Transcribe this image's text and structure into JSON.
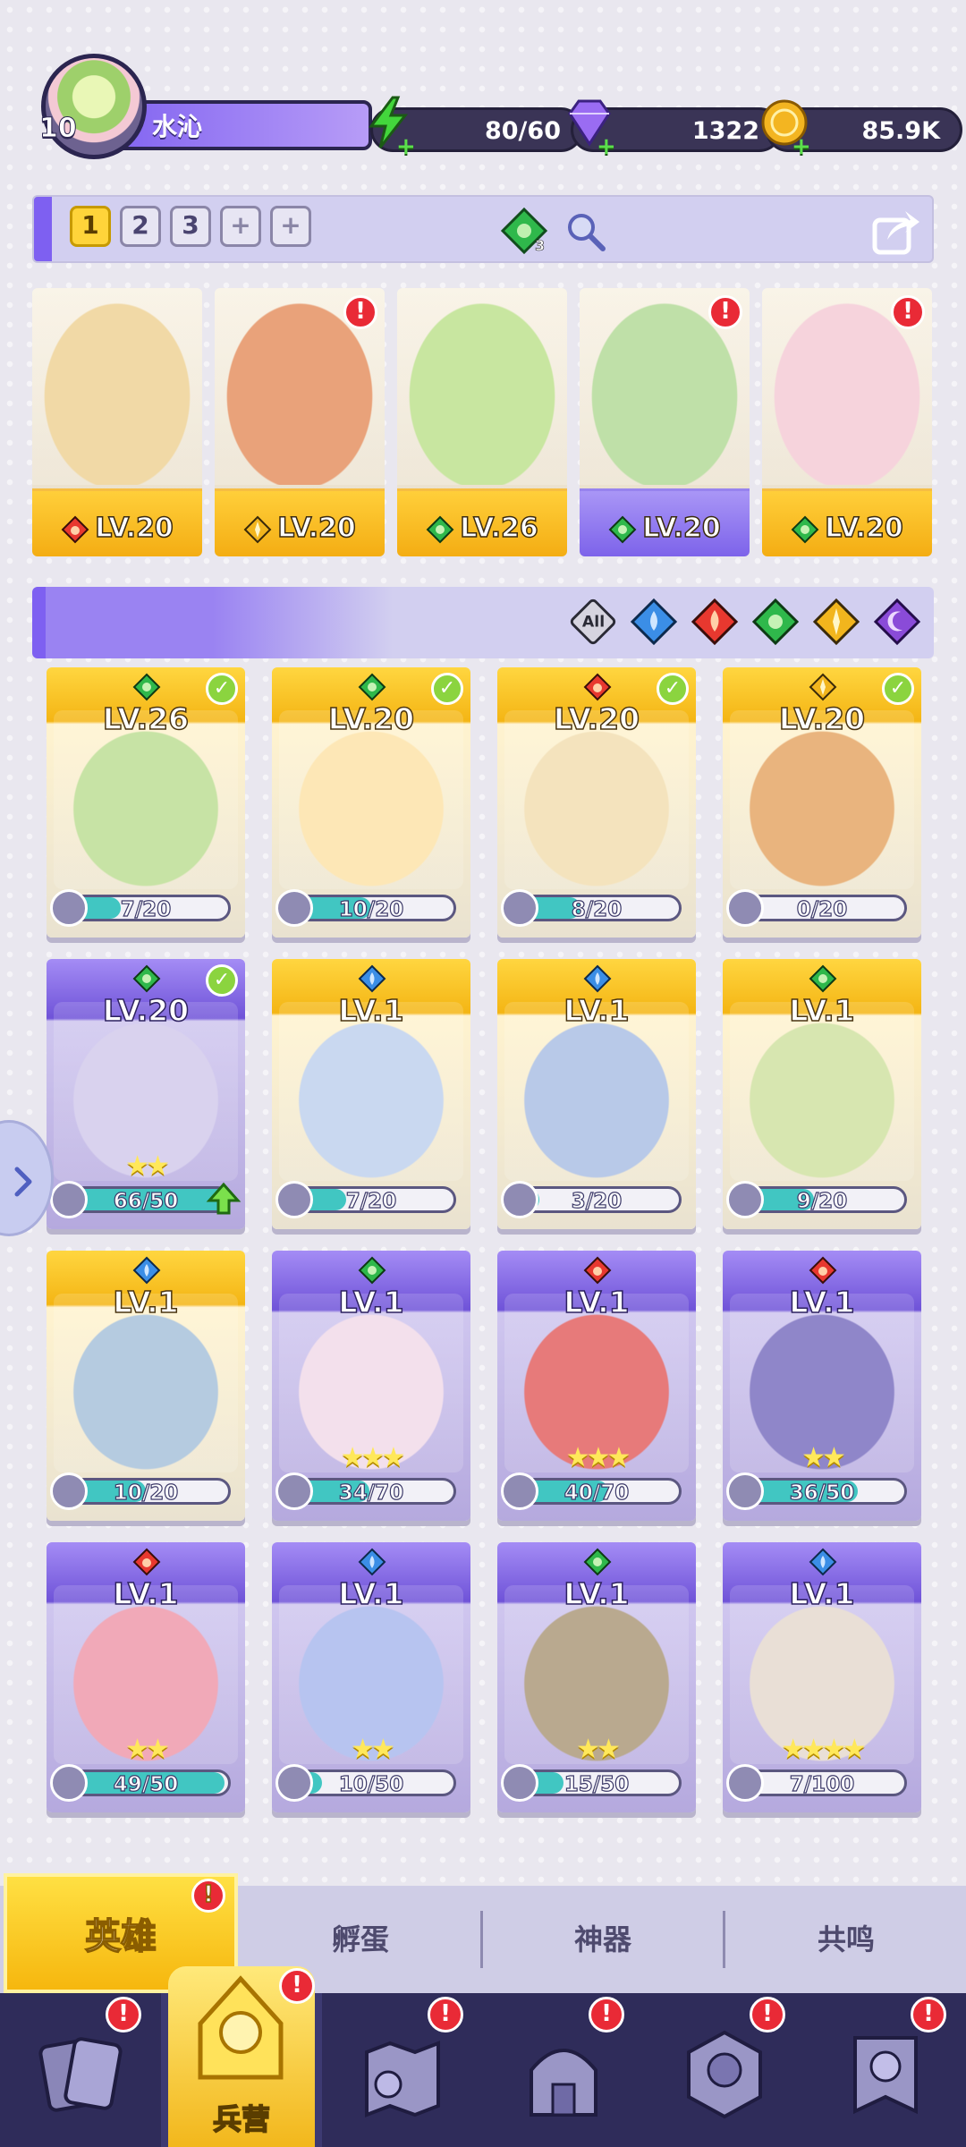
{
  "player": {
    "level": "10",
    "name": "水沁"
  },
  "resources": [
    {
      "name": "energy",
      "value": "80/60",
      "icon": "lightning-icon",
      "color": "#43d63c"
    },
    {
      "name": "gems",
      "value": "1322",
      "icon": "diamond-icon",
      "color": "#9a6cf2"
    },
    {
      "name": "coins",
      "value": "85.9K",
      "icon": "coin-icon",
      "color": "#f3b521"
    }
  ],
  "team_tabs": [
    "1",
    "2",
    "3",
    "+",
    "+"
  ],
  "team_badge_count": "3",
  "team": [
    {
      "level": "LV.20",
      "element": "fire",
      "alert": false,
      "art": "#f1d9a6"
    },
    {
      "level": "LV.20",
      "element": "light",
      "alert": true,
      "art": "#e9a27a"
    },
    {
      "level": "LV.26",
      "element": "nature",
      "alert": false,
      "art": "#c8e6a0"
    },
    {
      "level": "LV.20",
      "element": "nature",
      "alert": true,
      "art": "#bfe0a8",
      "frame": "purple"
    },
    {
      "level": "LV.20",
      "element": "nature",
      "alert": true,
      "art": "#f6d3dc"
    }
  ],
  "filters": [
    "All",
    "water",
    "fire",
    "nature",
    "light",
    "dark"
  ],
  "heroes": [
    {
      "level": "LV.26",
      "element": "nature",
      "progress": "7/20",
      "ratio": 0.35,
      "owned": true,
      "frame": "gold",
      "art": "#c7e3a5"
    },
    {
      "level": "LV.20",
      "element": "nature",
      "progress": "10/20",
      "ratio": 0.5,
      "owned": true,
      "frame": "gold",
      "art": "#fde7b6"
    },
    {
      "level": "LV.20",
      "element": "fire",
      "progress": "8/20",
      "ratio": 0.4,
      "owned": true,
      "frame": "gold",
      "art": "#f4e3bd"
    },
    {
      "level": "LV.20",
      "element": "light",
      "progress": "0/20",
      "ratio": 0.0,
      "owned": true,
      "frame": "gold",
      "art": "#e9b47e"
    },
    {
      "level": "LV.20",
      "element": "nature",
      "progress": "66/50",
      "ratio": 1.0,
      "owned": true,
      "frame": "purple",
      "art": "#d9d2ee",
      "stars": "★★",
      "upgrade": true
    },
    {
      "level": "LV.1",
      "element": "water",
      "progress": "7/20",
      "ratio": 0.35,
      "owned": false,
      "frame": "gold",
      "art": "#c9d8f0"
    },
    {
      "level": "LV.1",
      "element": "water",
      "progress": "3/20",
      "ratio": 0.15,
      "owned": false,
      "frame": "gold",
      "art": "#b8c9e8"
    },
    {
      "level": "LV.1",
      "element": "nature",
      "progress": "9/20",
      "ratio": 0.45,
      "owned": false,
      "frame": "gold",
      "art": "#d7e6b0"
    },
    {
      "level": "LV.1",
      "element": "water",
      "progress": "10/20",
      "ratio": 0.5,
      "owned": false,
      "frame": "gold",
      "art": "#b5cbe0"
    },
    {
      "level": "LV.1",
      "element": "nature",
      "progress": "34/70",
      "ratio": 0.49,
      "owned": false,
      "frame": "purple",
      "art": "#f3e0ec",
      "stars": "★★★"
    },
    {
      "level": "LV.1",
      "element": "fire",
      "progress": "40/70",
      "ratio": 0.57,
      "owned": false,
      "frame": "purple",
      "art": "#e77a7a",
      "stars": "★★★"
    },
    {
      "level": "LV.1",
      "element": "fire",
      "progress": "36/50",
      "ratio": 0.72,
      "owned": false,
      "frame": "purple",
      "art": "#8f86c9",
      "stars": "★★"
    },
    {
      "level": "LV.1",
      "element": "fire",
      "progress": "49/50",
      "ratio": 0.98,
      "owned": false,
      "frame": "purple",
      "art": "#f1a9b8",
      "stars": "★★"
    },
    {
      "level": "LV.1",
      "element": "water",
      "progress": "10/50",
      "ratio": 0.2,
      "owned": false,
      "frame": "purple",
      "art": "#b7c4f0",
      "stars": "★★"
    },
    {
      "level": "LV.1",
      "element": "nature",
      "progress": "15/50",
      "ratio": 0.3,
      "owned": false,
      "frame": "purple",
      "art": "#b9a98f",
      "stars": "★★"
    },
    {
      "level": "LV.1",
      "element": "water",
      "progress": "7/100",
      "ratio": 0.07,
      "owned": false,
      "frame": "purple",
      "art": "#e9dfd6",
      "stars": "★★★★"
    }
  ],
  "sub_tabs": [
    "英雄",
    "孵蛋",
    "神器",
    "共鸣"
  ],
  "nav": [
    {
      "icon": "cards-icon",
      "label": "",
      "alert": true
    },
    {
      "icon": "barracks-icon",
      "label": "兵营",
      "alert": true,
      "active": true
    },
    {
      "icon": "map-icon",
      "label": "",
      "alert": true
    },
    {
      "icon": "castle-icon",
      "label": "",
      "alert": true
    },
    {
      "icon": "guild-icon",
      "label": "",
      "alert": true
    },
    {
      "icon": "banner-icon",
      "label": "",
      "alert": true
    }
  ],
  "alert_mark": "!",
  "check_mark": "✓",
  "colors": {
    "fire": "#e8382f",
    "water": "#3b8ee6",
    "nature": "#2fb84b",
    "light": "#f2b51d",
    "dark": "#8a4bd8"
  }
}
